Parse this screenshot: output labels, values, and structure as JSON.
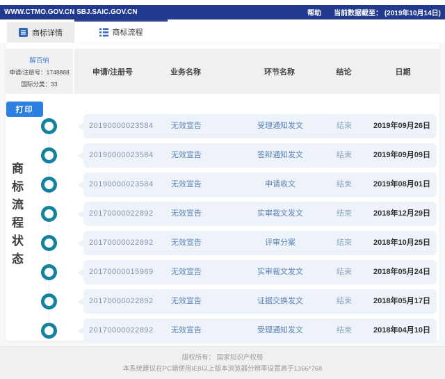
{
  "topbar": {
    "sites": "WWW.CTMO.GOV.CN SBJ.SAIC.GOV.CN",
    "help": "帮助",
    "data_cutoff": "当前数据截至： (2019年10月14日)"
  },
  "tabs": [
    {
      "label": "商标详情",
      "icon": "document-icon",
      "active": false
    },
    {
      "label": "商标流程",
      "icon": "list-icon",
      "active": true
    }
  ],
  "trademark": {
    "name": "解百纳",
    "reg_label": "申请/注册号：",
    "reg_value": "1748888",
    "class_label": "国际分类：",
    "class_value": "33"
  },
  "print_button": "打印",
  "vertical_title": "商标流程状态",
  "table": {
    "headers": [
      "申请/注册号",
      "业务名称",
      "环节名称",
      "结论",
      "日期"
    ],
    "rows": [
      [
        "20190000023584",
        "无效宣告",
        "受理通知发文",
        "结束",
        "2019年09月26日"
      ],
      [
        "20190000023584",
        "无效宣告",
        "答辩通知发文",
        "结束",
        "2019年09月09日"
      ],
      [
        "20190000023584",
        "无效宣告",
        "申请收文",
        "结束",
        "2019年08月01日"
      ],
      [
        "20170000022892",
        "无效宣告",
        "实审裁文发文",
        "结束",
        "2018年12月29日"
      ],
      [
        "20170000022892",
        "无效宣告",
        "评审分案",
        "结束",
        "2018年10月25日"
      ],
      [
        "20170000015969",
        "无效宣告",
        "实审裁文发文",
        "结束",
        "2018年05月24日"
      ],
      [
        "20170000022892",
        "无效宣告",
        "证据交换发文",
        "结束",
        "2018年05月17日"
      ],
      [
        "20170000022892",
        "无效宣告",
        "受理通知发文",
        "结束",
        "2018年04月10日"
      ]
    ]
  },
  "footer": {
    "line1": "版权所有： 国家知识产权局",
    "line2": "本系统建议在PC端使用IE8以上版本浏览器分辨率设置高于1366*768"
  },
  "colors": {
    "topbar": "#21398E",
    "accent": "#2E80E0",
    "teal": "#12829F",
    "row_bg": "#EDF3F9",
    "link_blue": "#5B82B8"
  }
}
